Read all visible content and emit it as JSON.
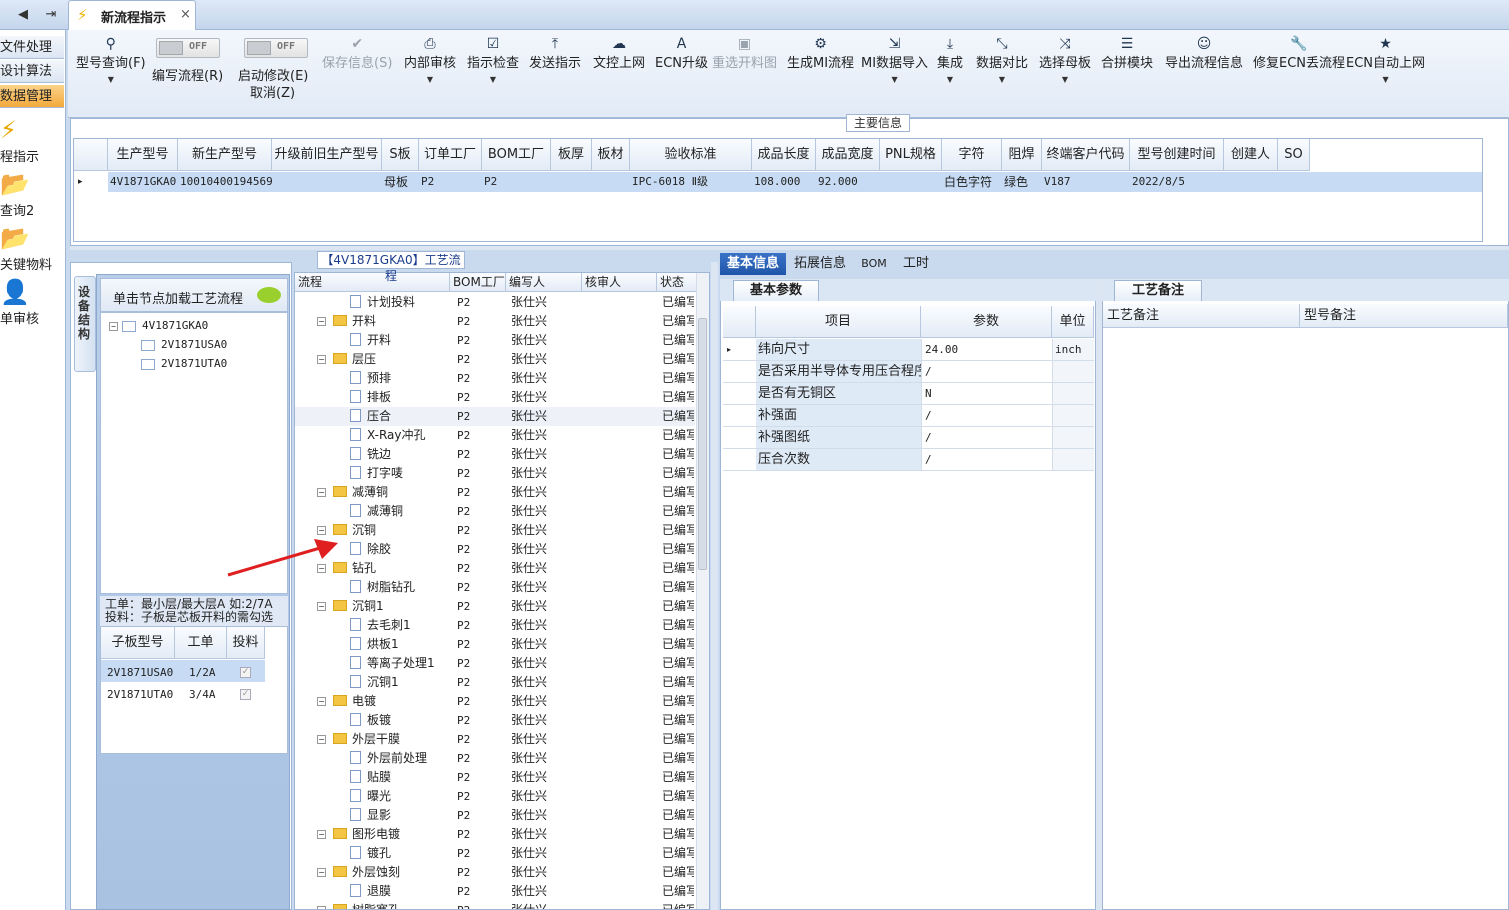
{
  "tabs": {
    "active_label": "新流程指示",
    "close": "×"
  },
  "nav": {
    "back": "◀",
    "forward": "⇥"
  },
  "left_nav": {
    "items": [
      "文件处理",
      "设计算法",
      "数据管理"
    ],
    "active_index": 2,
    "big_items": [
      "程指示",
      "查询2",
      "关键物料",
      "单审核"
    ]
  },
  "ribbon": {
    "query": "型号查询(F)",
    "toggle_off": "OFF",
    "edit_flow": "编写流程(R)",
    "start_modify": "启动修改(E)",
    "cancel": "取消(Z)",
    "save": "保存信息(S)",
    "internal_review": "内部审核",
    "check": "指示检查",
    "send": "发送指示",
    "doc_upload": "文控上网",
    "ecn_upgrade": "ECN升级",
    "reselect": "重选开料图",
    "gen_mi": "生成MI流程",
    "mi_import": "MI数据导入",
    "integrate": "集成",
    "compare": "数据对比",
    "choose_mother": "选择母板",
    "merge_module": "合拼模块",
    "export_info": "导出流程信息",
    "fix_ecn": "修复ECN丢流程",
    "ecn_auto": "ECN自动上网"
  },
  "main_info": {
    "title": "主要信息",
    "columns": [
      "生产型号",
      "新生产型号",
      "升级前旧生产型号",
      "S板",
      "订单工厂",
      "BOM工厂",
      "板厚",
      "板材",
      "验收标准",
      "成品长度",
      "成品宽度",
      "PNL规格",
      "字符",
      "阻焊",
      "终端客户代码",
      "型号创建时间",
      "创建人",
      "SO"
    ],
    "row": {
      "marker": "▸",
      "model": "4V1871GKA0",
      "new_model": "10010400194569",
      "s_board": "母板",
      "order_factory": "P2",
      "bom_factory": "P2",
      "standard": "IPC-6018 Ⅱ级",
      "length": "108.000",
      "width": "92.000",
      "char": "白色字符",
      "mask": "绿色",
      "customer": "V187",
      "created": "2022/8/5"
    }
  },
  "device": {
    "tab": "设备结构",
    "hint": "单击节点加载工艺流程",
    "tree": [
      "4V1871GKA0",
      "2V1871USA0",
      "2V1871UTA0"
    ],
    "note1": "工单：最小层/最大层A 如:2/7A",
    "note2": "投料：子板是芯板开料的需勾选",
    "sub_columns": [
      "子板型号",
      "工单",
      "投料"
    ],
    "sub_rows": [
      {
        "model": "2V1871USA0",
        "order": "1/2A"
      },
      {
        "model": "2V1871UTA0",
        "order": "3/4A"
      }
    ]
  },
  "flow": {
    "title": "【4V1871GKA0】工艺流程",
    "columns": [
      "流程",
      "BOM工厂",
      "编写人",
      "核审人",
      "状态"
    ],
    "rows": [
      {
        "name": "计划投料",
        "level": 1,
        "bom": "P2",
        "writer": "张仕兴",
        "status": "已编写"
      },
      {
        "name": "开料",
        "level": 0,
        "bom": "P2",
        "writer": "张仕兴",
        "status": "已编写"
      },
      {
        "name": "开料",
        "level": 1,
        "bom": "P2",
        "writer": "张仕兴",
        "status": "已编写"
      },
      {
        "name": "层压",
        "level": 0,
        "bom": "P2",
        "writer": "张仕兴",
        "status": "已编写"
      },
      {
        "name": "预排",
        "level": 1,
        "bom": "P2",
        "writer": "张仕兴",
        "status": "已编写"
      },
      {
        "name": "排板",
        "level": 1,
        "bom": "P2",
        "writer": "张仕兴",
        "status": "已编写"
      },
      {
        "name": "压合",
        "level": 1,
        "bom": "P2",
        "writer": "张仕兴",
        "status": "已编写"
      },
      {
        "name": "X-Ray冲孔",
        "level": 1,
        "bom": "P2",
        "writer": "张仕兴",
        "status": "已编写"
      },
      {
        "name": "铣边",
        "level": 1,
        "bom": "P2",
        "writer": "张仕兴",
        "status": "已编写"
      },
      {
        "name": "打字唛",
        "level": 1,
        "bom": "P2",
        "writer": "张仕兴",
        "status": "已编写"
      },
      {
        "name": "减薄铜",
        "level": 0,
        "bom": "P2",
        "writer": "张仕兴",
        "status": "已编写"
      },
      {
        "name": "减薄铜",
        "level": 1,
        "bom": "P2",
        "writer": "张仕兴",
        "status": "已编写"
      },
      {
        "name": "沉铜",
        "level": 0,
        "bom": "P2",
        "writer": "张仕兴",
        "status": "已编写"
      },
      {
        "name": "除胶",
        "level": 1,
        "bom": "P2",
        "writer": "张仕兴",
        "status": "已编写"
      },
      {
        "name": "钻孔",
        "level": 0,
        "bom": "P2",
        "writer": "张仕兴",
        "status": "已编写"
      },
      {
        "name": "树脂钻孔",
        "level": 1,
        "bom": "P2",
        "writer": "张仕兴",
        "status": "已编写"
      },
      {
        "name": "沉铜1",
        "level": 0,
        "bom": "P2",
        "writer": "张仕兴",
        "status": "已编写"
      },
      {
        "name": "去毛刺1",
        "level": 1,
        "bom": "P2",
        "writer": "张仕兴",
        "status": "已编写"
      },
      {
        "name": "烘板1",
        "level": 1,
        "bom": "P2",
        "writer": "张仕兴",
        "status": "已编写"
      },
      {
        "name": "等离子处理1",
        "level": 1,
        "bom": "P2",
        "writer": "张仕兴",
        "status": "已编写"
      },
      {
        "name": "沉铜1",
        "level": 1,
        "bom": "P2",
        "writer": "张仕兴",
        "status": "已编写"
      },
      {
        "name": "电镀",
        "level": 0,
        "bom": "P2",
        "writer": "张仕兴",
        "status": "已编写"
      },
      {
        "name": "板镀",
        "level": 1,
        "bom": "P2",
        "writer": "张仕兴",
        "status": "已编写"
      },
      {
        "name": "外层干膜",
        "level": 0,
        "bom": "P2",
        "writer": "张仕兴",
        "status": "已编写"
      },
      {
        "name": "外层前处理",
        "level": 1,
        "bom": "P2",
        "writer": "张仕兴",
        "status": "已编写"
      },
      {
        "name": "贴膜",
        "level": 1,
        "bom": "P2",
        "writer": "张仕兴",
        "status": "已编写"
      },
      {
        "name": "曝光",
        "level": 1,
        "bom": "P2",
        "writer": "张仕兴",
        "status": "已编写"
      },
      {
        "name": "显影",
        "level": 1,
        "bom": "P2",
        "writer": "张仕兴",
        "status": "已编写"
      },
      {
        "name": "图形电镀",
        "level": 0,
        "bom": "P2",
        "writer": "张仕兴",
        "status": "已编写"
      },
      {
        "name": "镀孔",
        "level": 1,
        "bom": "P2",
        "writer": "张仕兴",
        "status": "已编写"
      },
      {
        "name": "外层蚀刻",
        "level": 0,
        "bom": "P2",
        "writer": "张仕兴",
        "status": "已编写"
      },
      {
        "name": "退膜",
        "level": 1,
        "bom": "P2",
        "writer": "张仕兴",
        "status": "已编写"
      },
      {
        "name": "树脂塞孔",
        "level": 0,
        "bom": "P2",
        "writer": "张仕兴",
        "status": "已编写"
      }
    ]
  },
  "right": {
    "tabs": [
      "基本信息",
      "拓展信息",
      "BOM",
      "工时"
    ],
    "basic_tab": "基本参数",
    "param_columns": [
      "项目",
      "参数",
      "单位"
    ],
    "params": [
      {
        "item": "纬向尺寸",
        "value": "24.00",
        "unit": "inch"
      },
      {
        "item": "是否采用半导体专用压合程序",
        "value": "/",
        "unit": ""
      },
      {
        "item": "是否有无铜区",
        "value": "N",
        "unit": ""
      },
      {
        "item": "补强面",
        "value": "/",
        "unit": ""
      },
      {
        "item": "补强图纸",
        "value": "/",
        "unit": ""
      },
      {
        "item": "压合次数",
        "value": "/",
        "unit": ""
      }
    ],
    "note_tab": "工艺备注",
    "note_columns": [
      "工艺备注",
      "型号备注"
    ]
  },
  "colors": {
    "accent": "#1f55a8",
    "arrow": "#e02020",
    "folder": "#f4c542"
  }
}
